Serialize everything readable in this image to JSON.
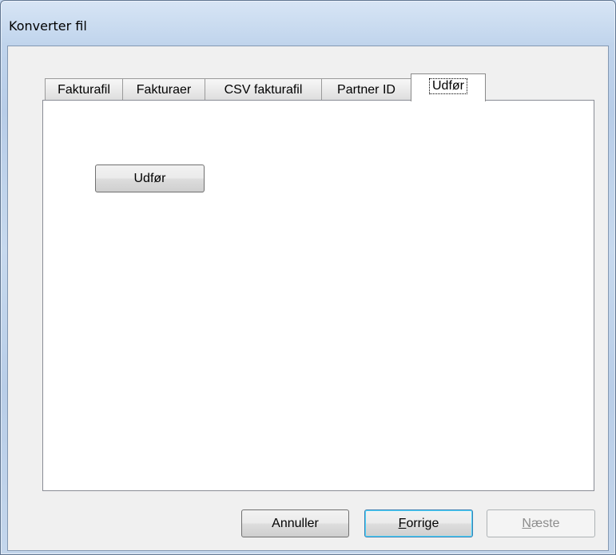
{
  "window": {
    "title": "Konverter fil"
  },
  "tabs": [
    {
      "label": "Fakturafil"
    },
    {
      "label": "Fakturaer"
    },
    {
      "label": "CSV fakturafil"
    },
    {
      "label": "Partner ID"
    },
    {
      "label": "Udfør",
      "active": true
    }
  ],
  "page": {
    "execute_button": "Udfør"
  },
  "footer": {
    "cancel": "Annuller",
    "previous_mnemonic": "F",
    "previous_rest": "orrige",
    "next_mnemonic": "N",
    "next_rest": "æste",
    "next_disabled": true
  }
}
